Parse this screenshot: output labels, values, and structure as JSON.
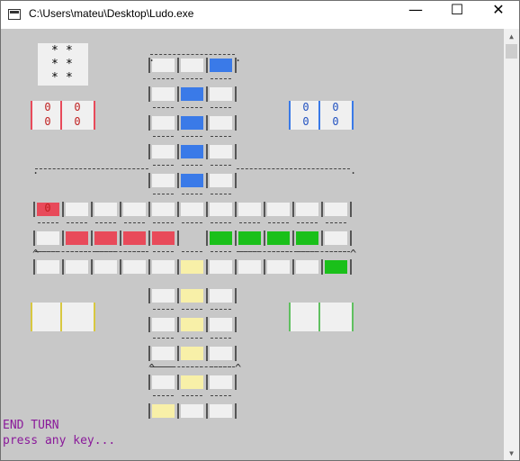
{
  "window": {
    "title": "C:\\Users\\mateu\\Desktop\\Ludo.exe",
    "minimize_glyph": "—",
    "maximize_glyph": "☐",
    "close_glyph": "✕"
  },
  "dice": {
    "value": 6,
    "pip": "*"
  },
  "colors": {
    "red": "#e84a5a",
    "blue": "#3a7ae8",
    "green": "#1ac01a",
    "yellow": "#f8f0a8",
    "empty": "#f0f0f0",
    "red_text": "#c02020",
    "blue_text": "#2050c0",
    "status": "#8a1a9a"
  },
  "bases": {
    "red": {
      "pieces": [
        "0",
        "0",
        "0",
        "0"
      ]
    },
    "blue": {
      "pieces": [
        "0",
        "0",
        "0",
        "0"
      ]
    },
    "yellow": {
      "pieces": []
    },
    "green": {
      "pieces": []
    }
  },
  "board": {
    "top_arm": [
      [
        "e",
        "e",
        "b"
      ],
      [
        "e",
        "b",
        "e"
      ],
      [
        "e",
        "b",
        "e"
      ],
      [
        "e",
        "b",
        "e"
      ],
      [
        "e",
        "b",
        "e"
      ]
    ],
    "middle_rows": [
      [
        "r0",
        "e",
        "e",
        "e",
        "e",
        "e",
        "e",
        "e",
        "e",
        "e",
        "e"
      ],
      [
        "e",
        "r",
        "r",
        "r",
        "r",
        "c",
        "g",
        "g",
        "g",
        "g",
        "e"
      ],
      [
        "e",
        "e",
        "e",
        "e",
        "e",
        "y",
        "e",
        "e",
        "e",
        "e",
        "g"
      ]
    ],
    "bottom_arm": [
      [
        "e",
        "y",
        "e"
      ],
      [
        "e",
        "y",
        "e"
      ],
      [
        "e",
        "y",
        "e"
      ],
      [
        "e",
        "y",
        "e"
      ],
      [
        "y",
        "e",
        "e"
      ]
    ],
    "red_piece_label": "0"
  },
  "status": {
    "line1": "END TURN",
    "line2": "press any key..."
  }
}
